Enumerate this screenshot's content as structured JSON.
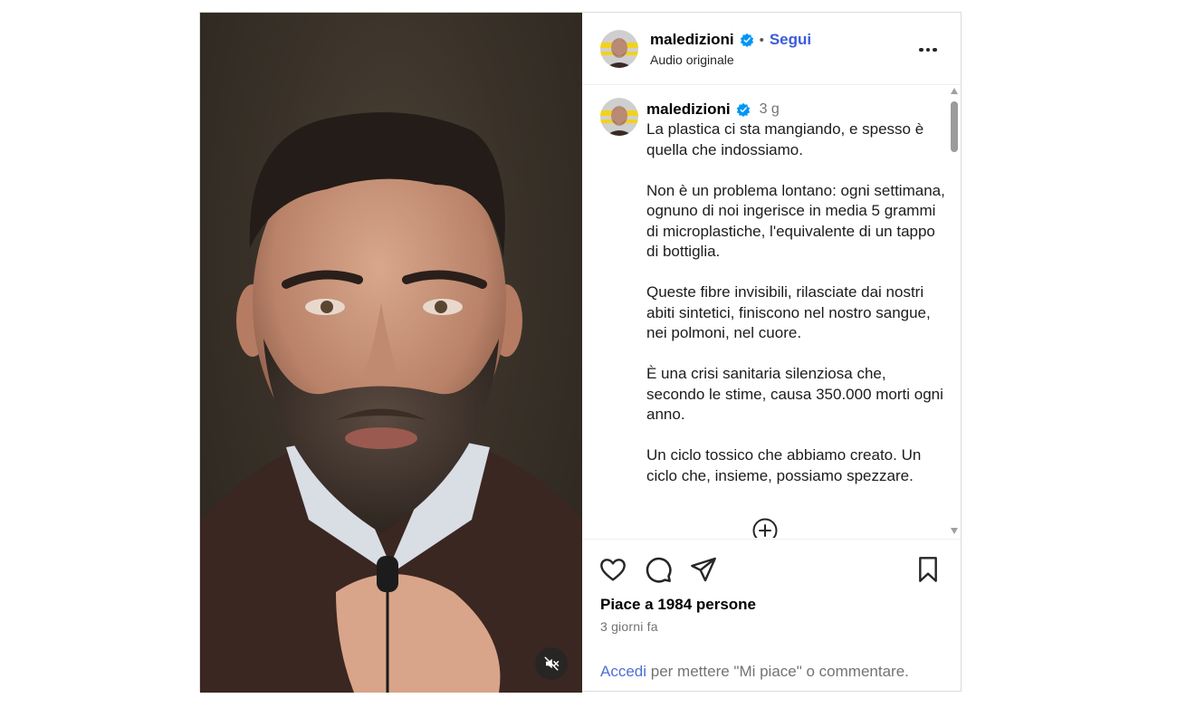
{
  "header": {
    "username": "maledizioni",
    "dot": "•",
    "follow_label": "Segui",
    "audio_label": "Audio originale"
  },
  "comment": {
    "username": "maledizioni",
    "time": "3 g",
    "caption": "La plastica ci sta mangiando, e spesso è quella che indossiamo.\n\nNon è un problema lontano: ogni settimana, ognuno di noi ingerisce in media 5 grammi di microplastiche, l'equivalente di un tappo di bottiglia.\n\nQueste fibre invisibili, rilasciate dai nostri abiti sintetici, finiscono nel nostro sangue, nei polmoni, nel cuore.\n\nÈ una crisi sanitaria silenziosa che, secondo le stime, causa 350.000 morti ogni anno.\n\nUn ciclo tossico che abbiamo creato. Un ciclo che, insieme, possiamo spezzare."
  },
  "footer": {
    "likes_text": "Piace a 1984 persone",
    "date_text": "3 giorni fa",
    "login_link": "Accedi",
    "login_rest": " per mettere \"Mi piace\" o commentare."
  },
  "colors": {
    "accent": "#4f6fd6",
    "follow": "#3b5bdb",
    "verified": "#0095f6",
    "muted_text": "#737373"
  },
  "icons": {
    "like": "heart-icon",
    "comment": "comment-icon",
    "share": "share-icon",
    "save": "bookmark-icon",
    "more": "more-options-icon",
    "mute": "speaker-muted-icon",
    "load_more": "plus-circle-icon"
  }
}
